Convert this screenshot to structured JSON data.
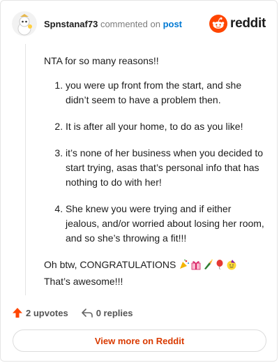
{
  "header": {
    "username": "Spnstanaf73",
    "action": "commented on",
    "post_link": "post",
    "logo_text": "reddit"
  },
  "comment": {
    "intro": "NTA for so many reasons!!",
    "items": [
      "you were up front from the start, and she didn’t seem to have a problem then.",
      "It is after all your home, to do as you like!",
      "it’s none of her business when you decided to start trying, asas that’s personal info that has nothing to do with her!",
      "She knew you were trying and if either jealous, and/or worried about losing her room, and so she’s throwing a fit!!!"
    ],
    "congrats_text": "Oh btw, CONGRATULATIONS",
    "outro": "That’s awesome!!!"
  },
  "footer": {
    "upvotes": "2 upvotes",
    "replies": "0 replies"
  },
  "view_more_label": "View more on Reddit",
  "colors": {
    "accent": "#d93a00",
    "reddit_orange": "#ff4500",
    "link_blue": "#0079d3"
  }
}
